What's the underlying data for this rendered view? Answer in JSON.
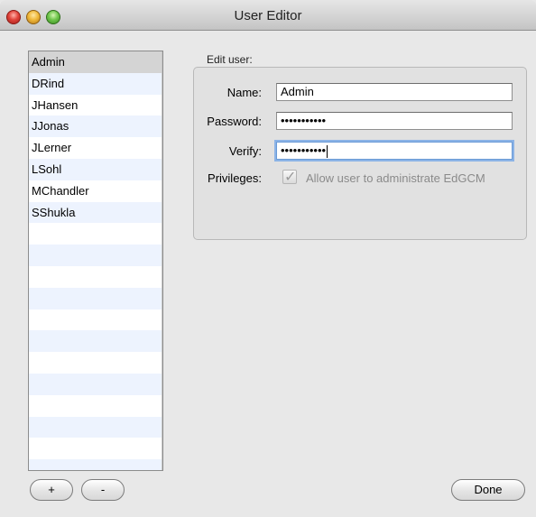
{
  "window": {
    "title": "User Editor",
    "titlebar_overflow_text_left": "... ... ...",
    "titlebar_overflow_text_right": "... ... ..."
  },
  "users": [
    {
      "name": "Admin",
      "selected": true
    },
    {
      "name": "DRind",
      "selected": false
    },
    {
      "name": "JHansen",
      "selected": false
    },
    {
      "name": "JJonas",
      "selected": false
    },
    {
      "name": "JLerner",
      "selected": false
    },
    {
      "name": "LSohl",
      "selected": false
    },
    {
      "name": "MChandler",
      "selected": false
    },
    {
      "name": "SShukla",
      "selected": false
    }
  ],
  "edit": {
    "group_label": "Edit user:",
    "name_label": "Name:",
    "name_value": "Admin",
    "password_label": "Password:",
    "password_value": "•••••••••••",
    "verify_label": "Verify:",
    "verify_value": "•••••••••••",
    "privileges_label": "Privileges:",
    "admin_checkbox_label": "Allow user to administrate EdGCM",
    "admin_checked": true
  },
  "buttons": {
    "add": "+",
    "remove": "-",
    "done": "Done"
  },
  "colors": {
    "selected_row": "#d4d4d4",
    "alt_row": "#edf3fe",
    "focus_ring": "#8bb3e6"
  }
}
